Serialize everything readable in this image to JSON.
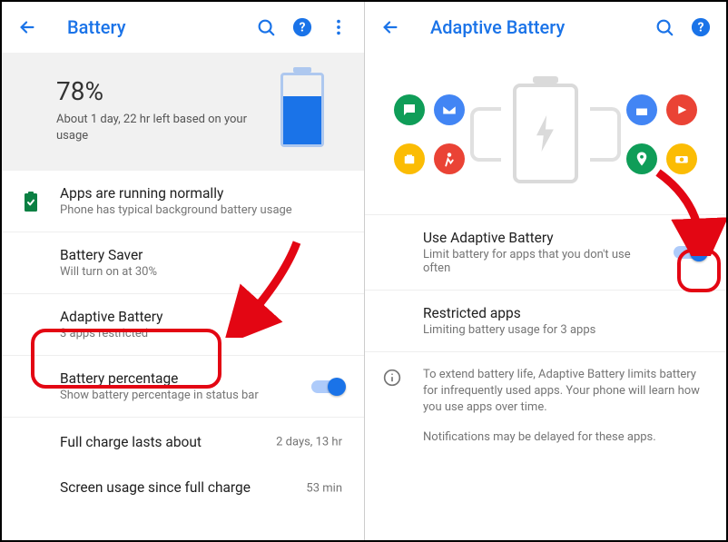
{
  "left": {
    "title": "Battery",
    "hero": {
      "percent": "78%",
      "estimate": "About 1 day, 22 hr left based on your usage",
      "fill_pct": 70
    },
    "rows": {
      "apps_normal": {
        "title": "Apps are running normally",
        "sub": "Phone has typical background battery usage"
      },
      "battery_saver": {
        "title": "Battery Saver",
        "sub": "Will turn on at 30%"
      },
      "adaptive": {
        "title": "Adaptive Battery",
        "sub": "3 apps restricted"
      },
      "percentage": {
        "title": "Battery percentage",
        "sub": "Show battery percentage in status bar",
        "toggle": true
      },
      "full_charge": {
        "title": "Full charge lasts about",
        "value": "2 days, 13 hr"
      },
      "screen_usage": {
        "title": "Screen usage since full charge",
        "value": "53 min"
      }
    }
  },
  "right": {
    "title": "Adaptive Battery",
    "rows": {
      "use_adaptive": {
        "title": "Use Adaptive Battery",
        "sub": "Limit battery for apps that you don't use often",
        "toggle": true
      },
      "restricted": {
        "title": "Restricted apps",
        "sub": "Limiting battery usage for 3 apps"
      }
    },
    "info": {
      "p1": "To extend battery life, Adaptive Battery limits battery for infrequently used apps. Your phone will learn how you use apps over time.",
      "p2": "Notifications may be delayed for these apps."
    }
  }
}
